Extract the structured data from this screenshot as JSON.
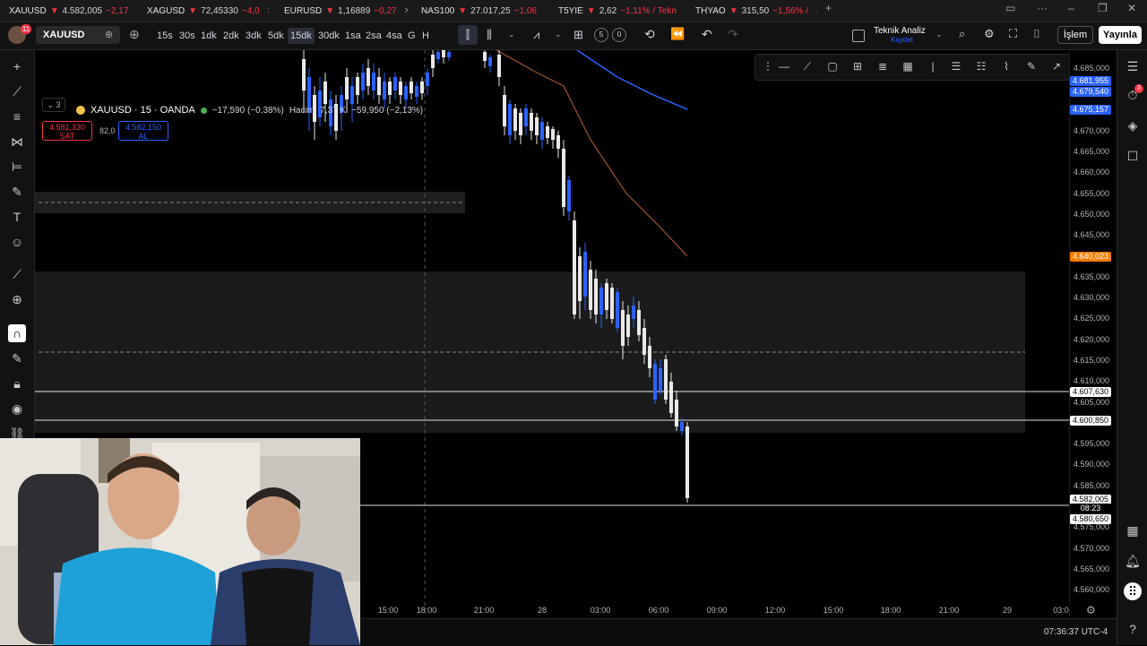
{
  "tabs": [
    {
      "symbol": "XAUUSD",
      "price": "4.582,005",
      "change": "−2,17",
      "color": "#f5c24b"
    },
    {
      "symbol": "XAGUSD",
      "price": "72,45330",
      "change": "−4,0",
      "color": "#c0c0c0"
    },
    {
      "symbol": "EURUSD",
      "price": "1,16889",
      "change": "−0,27",
      "color": "#3b6fe0"
    },
    {
      "symbol": "NAS100",
      "price": "27.017,25",
      "change": "−1,06",
      "color": "#2b8fd6"
    },
    {
      "symbol": "T5YIE",
      "price": "2,62",
      "change": "−1,11% / Tekn",
      "color": "#3b6fe0"
    },
    {
      "symbol": "THYAO",
      "price": "315,50",
      "change": "−1,56% /",
      "color": "#e53935"
    }
  ],
  "toolbar": {
    "notif_count": "11",
    "symbol": "XAUUSD",
    "intervals": [
      "15s",
      "30s",
      "1dk",
      "2dk",
      "3dk",
      "5dk",
      "15dk",
      "30dk",
      "1sa",
      "2sa",
      "4sa",
      "G",
      "H"
    ],
    "active_interval": "15dk",
    "counter_a": "5",
    "counter_b": "0",
    "layout_name": "Teknik Analiz",
    "layout_status": "Kaydet",
    "trade_label": "İşlem",
    "publish_label": "Yayınla"
  },
  "legend": {
    "title": "XAUUSD · 15 · OANDA",
    "change": "−17,590 (−0,38%)",
    "volume_label": "Hacim",
    "volume_value": "7,37 K",
    "volume_change": "−59,950 (−2,13%)",
    "sell_price": "4.581,330",
    "sell_label": "SAT",
    "spread": "82,0",
    "buy_price": "4.582,150",
    "buy_label": "AL",
    "collapsed_count": "3"
  },
  "price_axis": {
    "labels": [
      "4.685,000",
      "4.670,000",
      "4.665,000",
      "4.660,000",
      "4.655,000",
      "4.650,000",
      "4.645,000",
      "4.635,000",
      "4.630,000",
      "4.625,000",
      "4.620,000",
      "4.615,000",
      "4.610,000",
      "4.605,000",
      "4.595,000",
      "4.590,000",
      "4.585,000",
      "4.575,000",
      "4.570,000",
      "4.565,000",
      "4.560,000"
    ],
    "tags": [
      {
        "value": "4.681,955",
        "color": "#2962ff"
      },
      {
        "value": "4.679,540",
        "color": "#2962ff"
      },
      {
        "value": "4.675,157",
        "color": "#2962ff"
      },
      {
        "value": "4.640,023",
        "color": "#f57c00"
      },
      {
        "value": "4.607,630",
        "color": "#ffffff"
      },
      {
        "value": "4.600,850",
        "color": "#ffffff"
      },
      {
        "value": "4.582,005",
        "color": "#ffffff"
      },
      {
        "value": "4.580,650",
        "color": "#ffffff"
      }
    ],
    "countdown": "08:23"
  },
  "time_axis": [
    "15:00",
    "18:00",
    "21:00",
    "28",
    "03:00",
    "06:00",
    "09:00",
    "12:00",
    "15:00",
    "18:00",
    "21:00",
    "29",
    "03:0"
  ],
  "status": {
    "clock": "07:36:37 UTC-4"
  },
  "right_badge": "3"
}
